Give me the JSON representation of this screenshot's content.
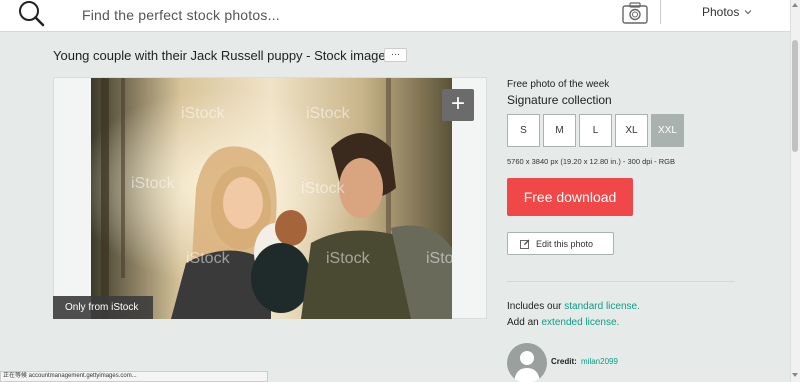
{
  "search": {
    "placeholder": "Find the perfect stock photos..."
  },
  "media_filter": {
    "selected": "Photos"
  },
  "asset": {
    "title": "Young couple with their Jack Russell puppy - Stock image",
    "more_label": "···",
    "exclusive_label": "Only from iStock",
    "plus_label": "+"
  },
  "sidebar": {
    "week_label": "Free photo of the week",
    "collection": "Signature collection",
    "sizes": [
      "S",
      "M",
      "L",
      "XL",
      "XXL"
    ],
    "selected_size": "XXL",
    "dimensions": "5760 x 3840 px (19.20 x 12.80 in.) - 300 dpi - RGB",
    "download_label": "Free download",
    "edit_label": "Edit this photo",
    "license_line1_prefix": "Includes our ",
    "license_line1_link": "standard license.",
    "license_line2_prefix": "Add an ",
    "license_line2_link": "extended license.",
    "credit_label": "Credit:",
    "credit_name": "milan2099"
  },
  "status_bar": {
    "text": "正在等候 accountmanagement.gettyimages.com..."
  },
  "colors": {
    "accent": "#08a087",
    "download": "#f04848",
    "selected_size": "#a9b2af"
  }
}
